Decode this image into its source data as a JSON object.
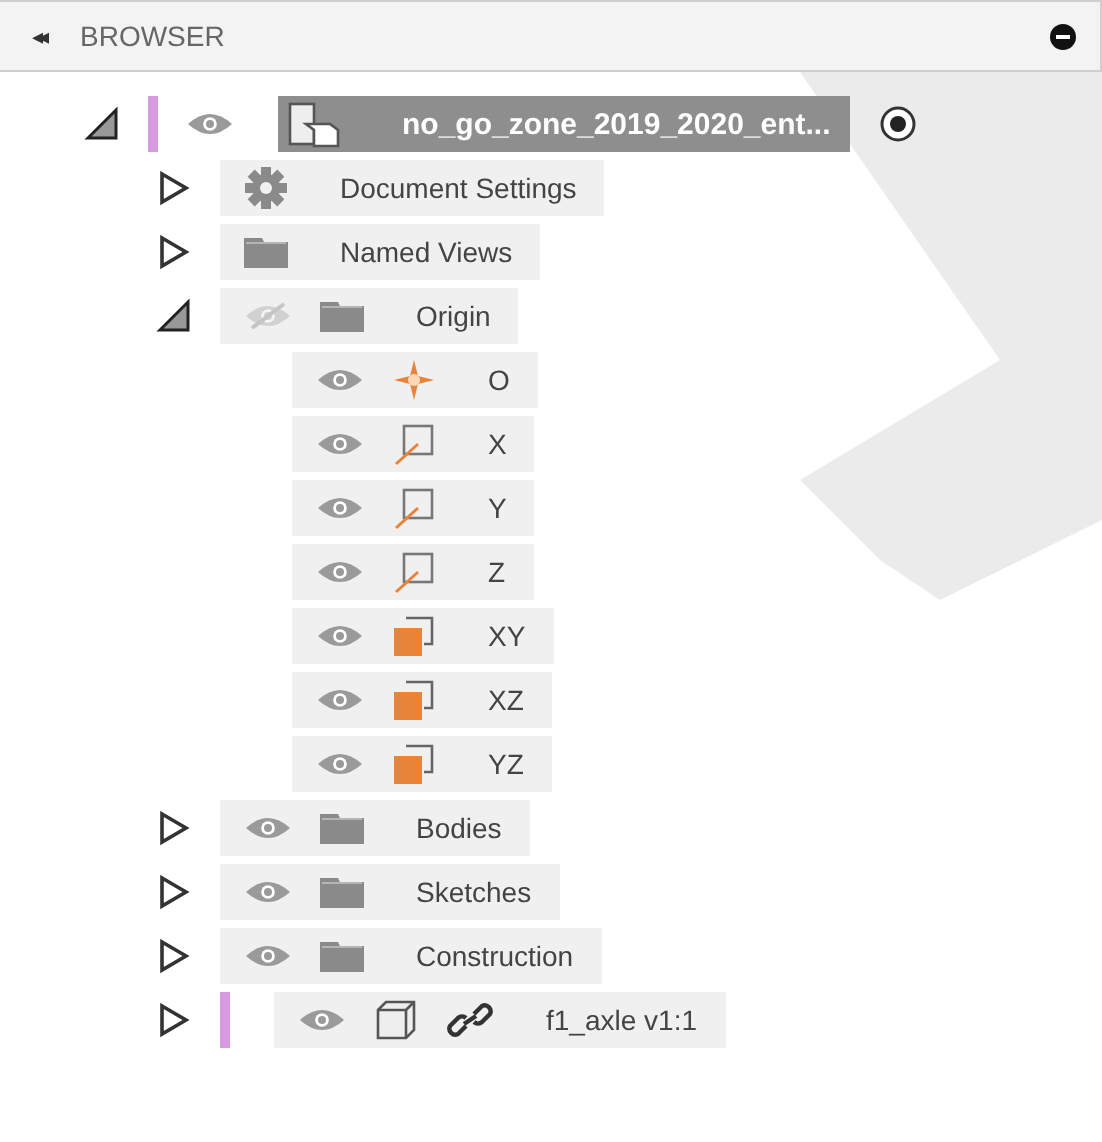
{
  "header": {
    "title": "BROWSER",
    "collapse_glyph": "◂◂"
  },
  "items": [
    {
      "kind": "root-component",
      "label": "no_go_zone_2019_2020_ent...",
      "expanded": true,
      "visible": true,
      "selected": true,
      "active": true,
      "children": [
        {
          "kind": "settings",
          "label": "Document Settings",
          "expanded": false,
          "selected": false
        },
        {
          "kind": "folder",
          "label": "Named Views",
          "expanded": false,
          "selected": false
        },
        {
          "kind": "folder",
          "label": "Origin",
          "expanded": true,
          "visible": false,
          "selected": false,
          "children": [
            {
              "kind": "point",
              "label": "O",
              "visible": true,
              "selected": false
            },
            {
              "kind": "axis",
              "label": "X",
              "visible": true,
              "selected": false
            },
            {
              "kind": "axis",
              "label": "Y",
              "visible": true,
              "selected": false
            },
            {
              "kind": "axis",
              "label": "Z",
              "visible": true,
              "selected": false
            },
            {
              "kind": "plane",
              "label": "XY",
              "visible": true,
              "selected": false
            },
            {
              "kind": "plane",
              "label": "XZ",
              "visible": true,
              "selected": false
            },
            {
              "kind": "plane",
              "label": "YZ",
              "visible": true,
              "selected": false
            }
          ]
        },
        {
          "kind": "folder",
          "label": "Bodies",
          "expanded": false,
          "visible": true,
          "selected": false
        },
        {
          "kind": "folder",
          "label": "Sketches",
          "expanded": false,
          "visible": true,
          "selected": false
        },
        {
          "kind": "folder",
          "label": "Construction",
          "expanded": false,
          "visible": true,
          "selected": false
        },
        {
          "kind": "linked-component",
          "label": "f1_axle v1:1",
          "expanded": false,
          "visible": true,
          "selected": false
        }
      ]
    }
  ]
}
